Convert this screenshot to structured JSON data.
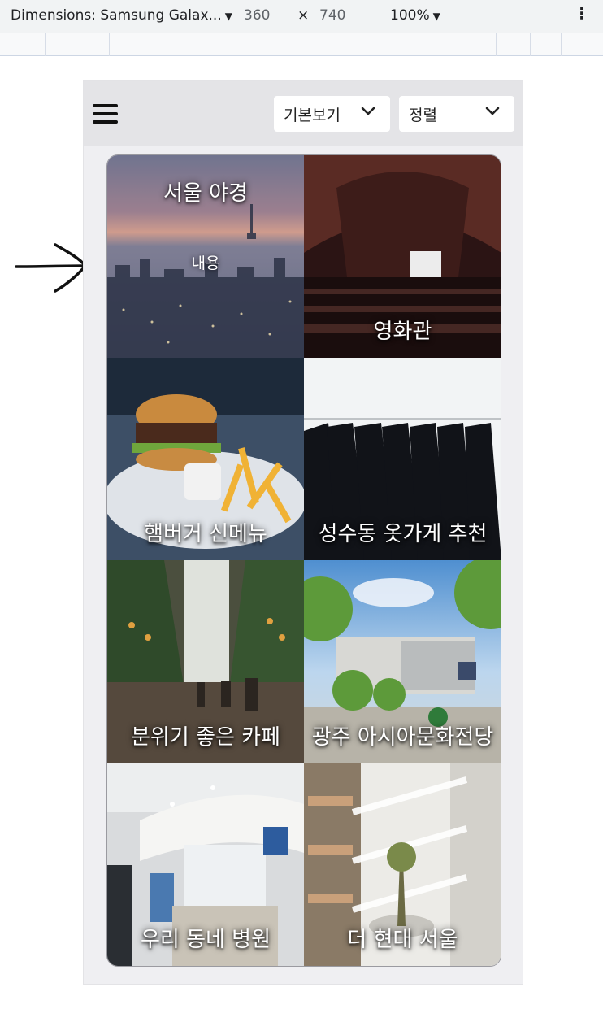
{
  "devtools": {
    "device_label": "Dimensions: Samsung Galax...",
    "width": "360",
    "times": "×",
    "height": "740",
    "zoom": "100%"
  },
  "topbar": {
    "view_select": "기본보기",
    "sort_select": "정렬"
  },
  "tiles": [
    {
      "title": "서울 야경",
      "content": "내용"
    },
    {
      "title": "영화관"
    },
    {
      "title": "햄버거 신메뉴"
    },
    {
      "title": "성수동 옷가게 추천"
    },
    {
      "title": "분위기 좋은 카페"
    },
    {
      "title": "광주 아시아문화전당"
    },
    {
      "title": "우리 동네 병원"
    },
    {
      "title": "더 현대 서울"
    }
  ]
}
